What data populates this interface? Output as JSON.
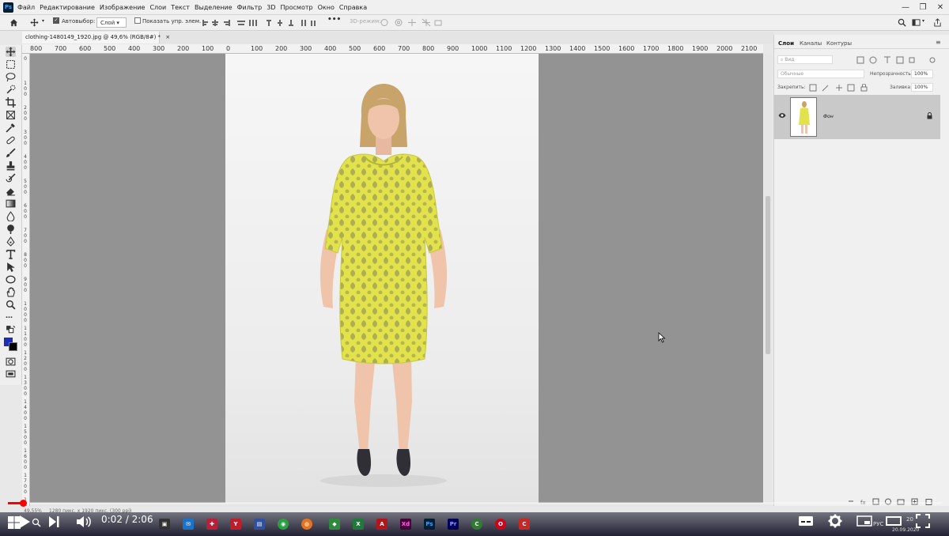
{
  "app": {
    "logo": "Ps",
    "menu": [
      "Файл",
      "Редактирование",
      "Изображение",
      "Слои",
      "Текст",
      "Выделение",
      "Фильтр",
      "3D",
      "Просмотр",
      "Окно",
      "Справка"
    ]
  },
  "options_bar": {
    "autoselect_label": "Автовыбор:",
    "autoselect_value": "Слой",
    "show_controls_label": "Показать упр. элем.",
    "more": "•••",
    "mode_3d": "3D-режим:"
  },
  "document": {
    "tab_title": "clothing-1480149_1920.jpg @ 49,6% (RGB/8#) *",
    "close": "×"
  },
  "ruler": {
    "h_labels": [
      "800",
      "700",
      "600",
      "500",
      "400",
      "300",
      "200",
      "100",
      "0",
      "100",
      "200",
      "300",
      "400",
      "500",
      "600",
      "700",
      "800",
      "900",
      "1000",
      "1100",
      "1200",
      "1300",
      "1400",
      "1500",
      "1600",
      "1700",
      "1800",
      "1900",
      "2000",
      "2100"
    ]
  },
  "panel": {
    "tabs": [
      "Слои",
      "Каналы",
      "Контуры"
    ],
    "search_placeholder": "Вид",
    "blend_mode": "Обычные",
    "opacity_label": "Непрозрачность:",
    "opacity_value": "100%",
    "lock_label": "Закрепить:",
    "fill_label": "Заливка:",
    "fill_value": "100%",
    "layer_name": "Фон"
  },
  "status": {
    "zoom": "49,55%",
    "doc_info": "1280 пикс. х 1920 пикс. (300 ppi)",
    "arrow": "›"
  },
  "video": {
    "time_current": "0:02",
    "time_separator": " / ",
    "time_total": "2:06",
    "progress_fraction": 0.016
  },
  "system": {
    "lang": "РУС",
    "date": "20.09.2020",
    "time": "20"
  }
}
